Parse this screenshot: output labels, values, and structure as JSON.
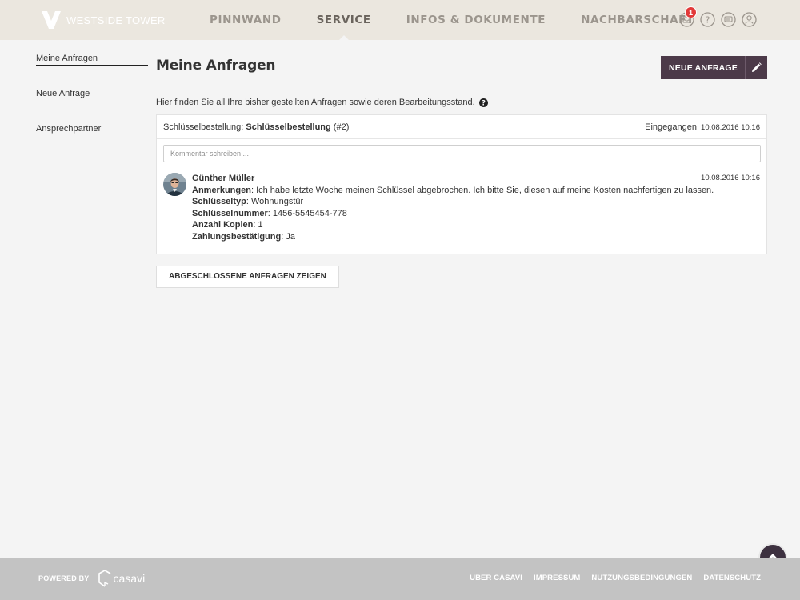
{
  "brand": {
    "name": "WESTSIDE TOWER"
  },
  "nav": {
    "items": [
      {
        "label": "PINNWAND",
        "active": false
      },
      {
        "label": "SERVICE",
        "active": true
      },
      {
        "label": "INFOS & DOKUMENTE",
        "active": false
      },
      {
        "label": "NACHBARSCHAFT",
        "active": false
      }
    ]
  },
  "header_icons": {
    "notifications_count": "1",
    "icons": [
      "inbox-icon",
      "help-icon",
      "chat-icon",
      "user-icon"
    ]
  },
  "sidebar": {
    "items": [
      {
        "label": "Meine Anfragen",
        "active": true
      },
      {
        "label": "Neue Anfrage",
        "active": false
      },
      {
        "label": "Ansprechpartner",
        "active": false
      }
    ]
  },
  "main": {
    "title": "Meine Anfragen",
    "new_request_button": "NEUE ANFRAGE",
    "intro": "Hier finden Sie all Ihre bisher gestellten Anfragen sowie deren Bearbeitungsstand.",
    "request": {
      "category": "Schlüsselbestellung:",
      "title": "Schlüsselbestellung",
      "number": "(#2)",
      "status_label": "Eingegangen",
      "status_date": "10.08.2016 10:16",
      "comment_placeholder": "Kommentar schreiben ...",
      "entry": {
        "author": "Günther Müller",
        "date": "10.08.2016 10:16",
        "fields": [
          {
            "label": "Anmerkungen",
            "value": ": Ich habe letzte Woche meinen Schlüssel abgebrochen. Ich bitte Sie, diesen auf meine Kosten nachfertigen zu lassen."
          },
          {
            "label": "Schlüsseltyp",
            "value": ": Wohnungstür"
          },
          {
            "label": "Schlüsselnummer",
            "value": ": 1456-5545454-778"
          },
          {
            "label": "Anzahl Kopien",
            "value": ": 1"
          },
          {
            "label": "Zahlungsbestätigung",
            "value": ": Ja"
          }
        ]
      }
    },
    "closed_button": "ABGESCHLOSSENE ANFRAGEN ZEIGEN"
  },
  "footer": {
    "powered_by": "POWERED BY",
    "vendor": "casavi",
    "links": [
      "ÜBER CASAVI",
      "IMPRESSUM",
      "NUTZUNGSBEDINGUNGEN",
      "DATENSCHUTZ"
    ]
  },
  "colors": {
    "topbar": "#ebe7df",
    "accent": "#4c3a49",
    "footer": "#c3c3c3",
    "badge": "#e23a3a"
  }
}
